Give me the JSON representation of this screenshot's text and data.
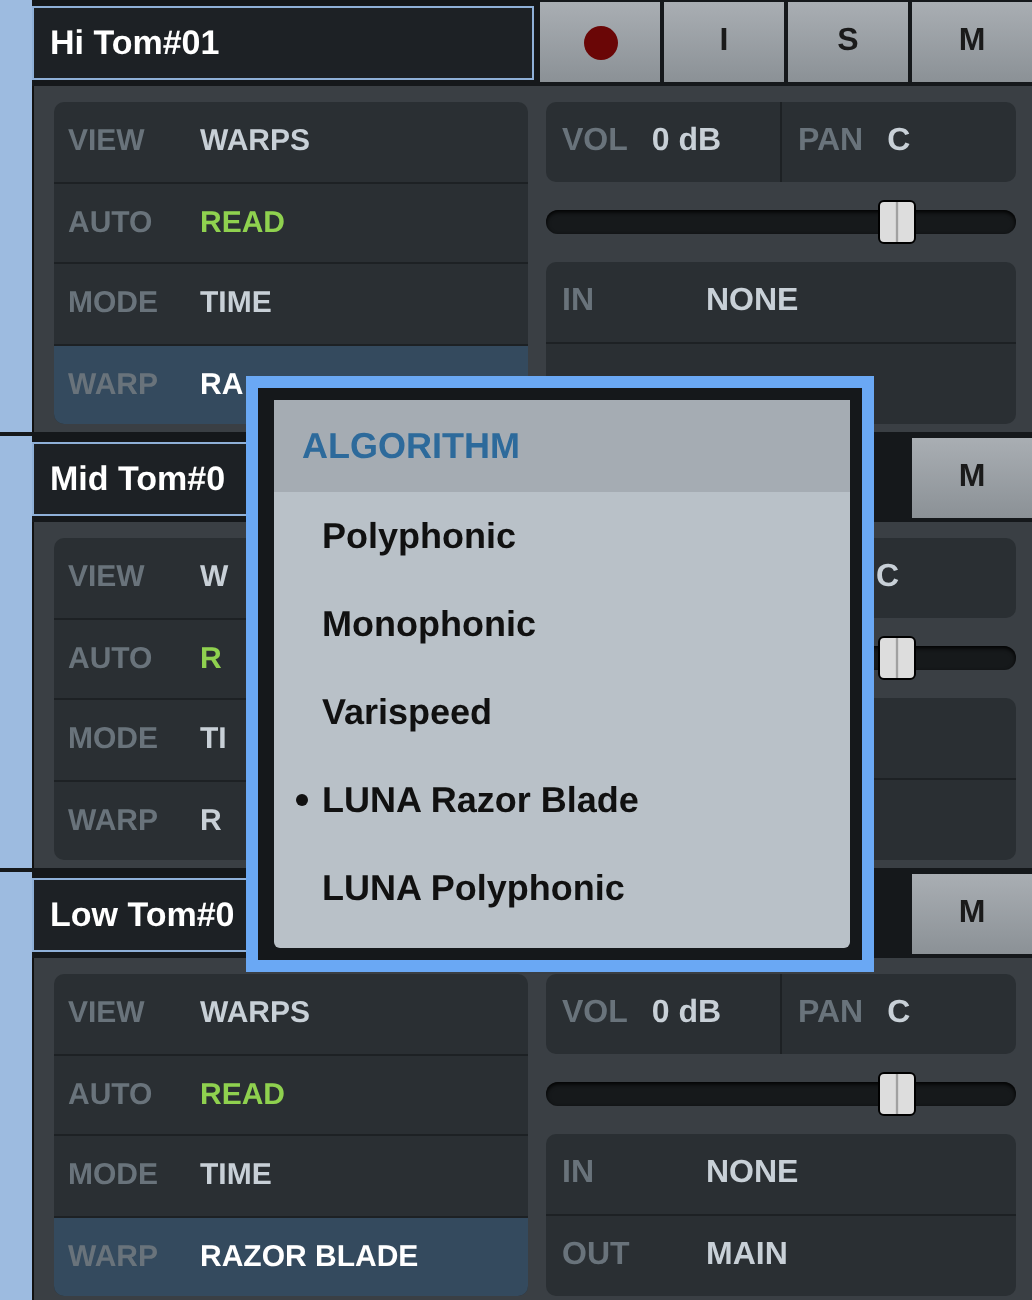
{
  "tracks": [
    {
      "name": "Hi Tom#01",
      "buttons": [
        {
          "kind": "record"
        },
        {
          "kind": "letter",
          "label": "I"
        },
        {
          "kind": "letter",
          "label": "S"
        },
        {
          "kind": "letter",
          "label": "M"
        }
      ],
      "rows": [
        {
          "label": "VIEW",
          "value": "WARPS",
          "selected": false
        },
        {
          "label": "AUTO",
          "value": "READ",
          "color": "#8fd14f",
          "selected": false
        },
        {
          "label": "MODE",
          "value": "TIME",
          "selected": false
        },
        {
          "label": "WARP",
          "value": "RA",
          "selected": true
        }
      ],
      "vol_label": "VOL",
      "vol": "0 dB",
      "pan_label": "PAN",
      "pan": "C",
      "fader": {
        "level": 0.75
      },
      "in_label": "IN",
      "in": "NONE"
    },
    {
      "name": "Mid Tom#0",
      "buttons": [
        {
          "kind": "letter",
          "label": "M"
        }
      ],
      "rows": [
        {
          "label": "VIEW",
          "value": "W",
          "selected": false
        },
        {
          "label": "AUTO",
          "value": "R",
          "color": "#8fd14f",
          "selected": false
        },
        {
          "label": "MODE",
          "value": "TI",
          "selected": false
        },
        {
          "label": "WARP",
          "value": "R",
          "selected": false
        }
      ],
      "pan": "C",
      "fader": {
        "level": 0.75
      }
    },
    {
      "name": "Low Tom#0",
      "buttons": [
        {
          "kind": "letter",
          "label": "M"
        }
      ],
      "rows": [
        {
          "label": "VIEW",
          "value": "WARPS",
          "selected": false
        },
        {
          "label": "AUTO",
          "value": "READ",
          "color": "#8fd14f",
          "selected": false
        },
        {
          "label": "MODE",
          "value": "TIME",
          "selected": false
        },
        {
          "label": "WARP",
          "value": "RAZOR BLADE",
          "selected": true
        }
      ],
      "vol_label": "VOL",
      "vol": "0 dB",
      "pan_label": "PAN",
      "pan": "C",
      "fader": {
        "level": 0.75
      },
      "in_label": "IN",
      "in": "NONE",
      "out_label": "OUT",
      "out": "MAIN"
    }
  ],
  "menu": {
    "header": "ALGORITHM",
    "items": [
      {
        "label": "Polyphonic",
        "selected": false
      },
      {
        "label": "Monophonic",
        "selected": false
      },
      {
        "label": "Varispeed",
        "selected": false
      },
      {
        "label": "LUNA Razor Blade",
        "selected": true
      },
      {
        "label": "LUNA Polyphonic",
        "selected": false
      }
    ]
  }
}
